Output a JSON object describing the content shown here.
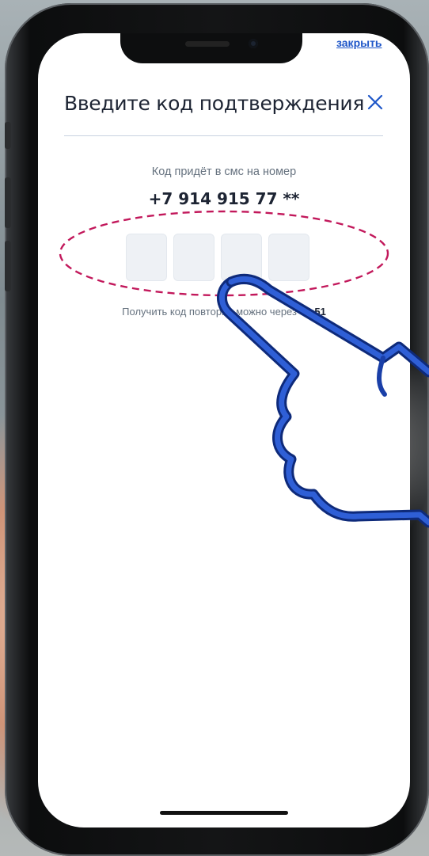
{
  "header": {
    "close_link": "закрыть",
    "title": "Введите код подтверждения"
  },
  "sms": {
    "hint": "Код придёт в смс на номер",
    "phone": "+7 914 915 77 **"
  },
  "code_inputs": [
    "",
    "",
    "",
    ""
  ],
  "resend": {
    "text": "Получить код повторно можно через",
    "timer": "04:51"
  },
  "icons": {
    "close": "close-icon",
    "pointer": "pointing-hand-icon"
  },
  "colors": {
    "accent": "#1e56c8",
    "highlight_ellipse": "#c2185b",
    "hand_outline": "#1a3fa8"
  }
}
